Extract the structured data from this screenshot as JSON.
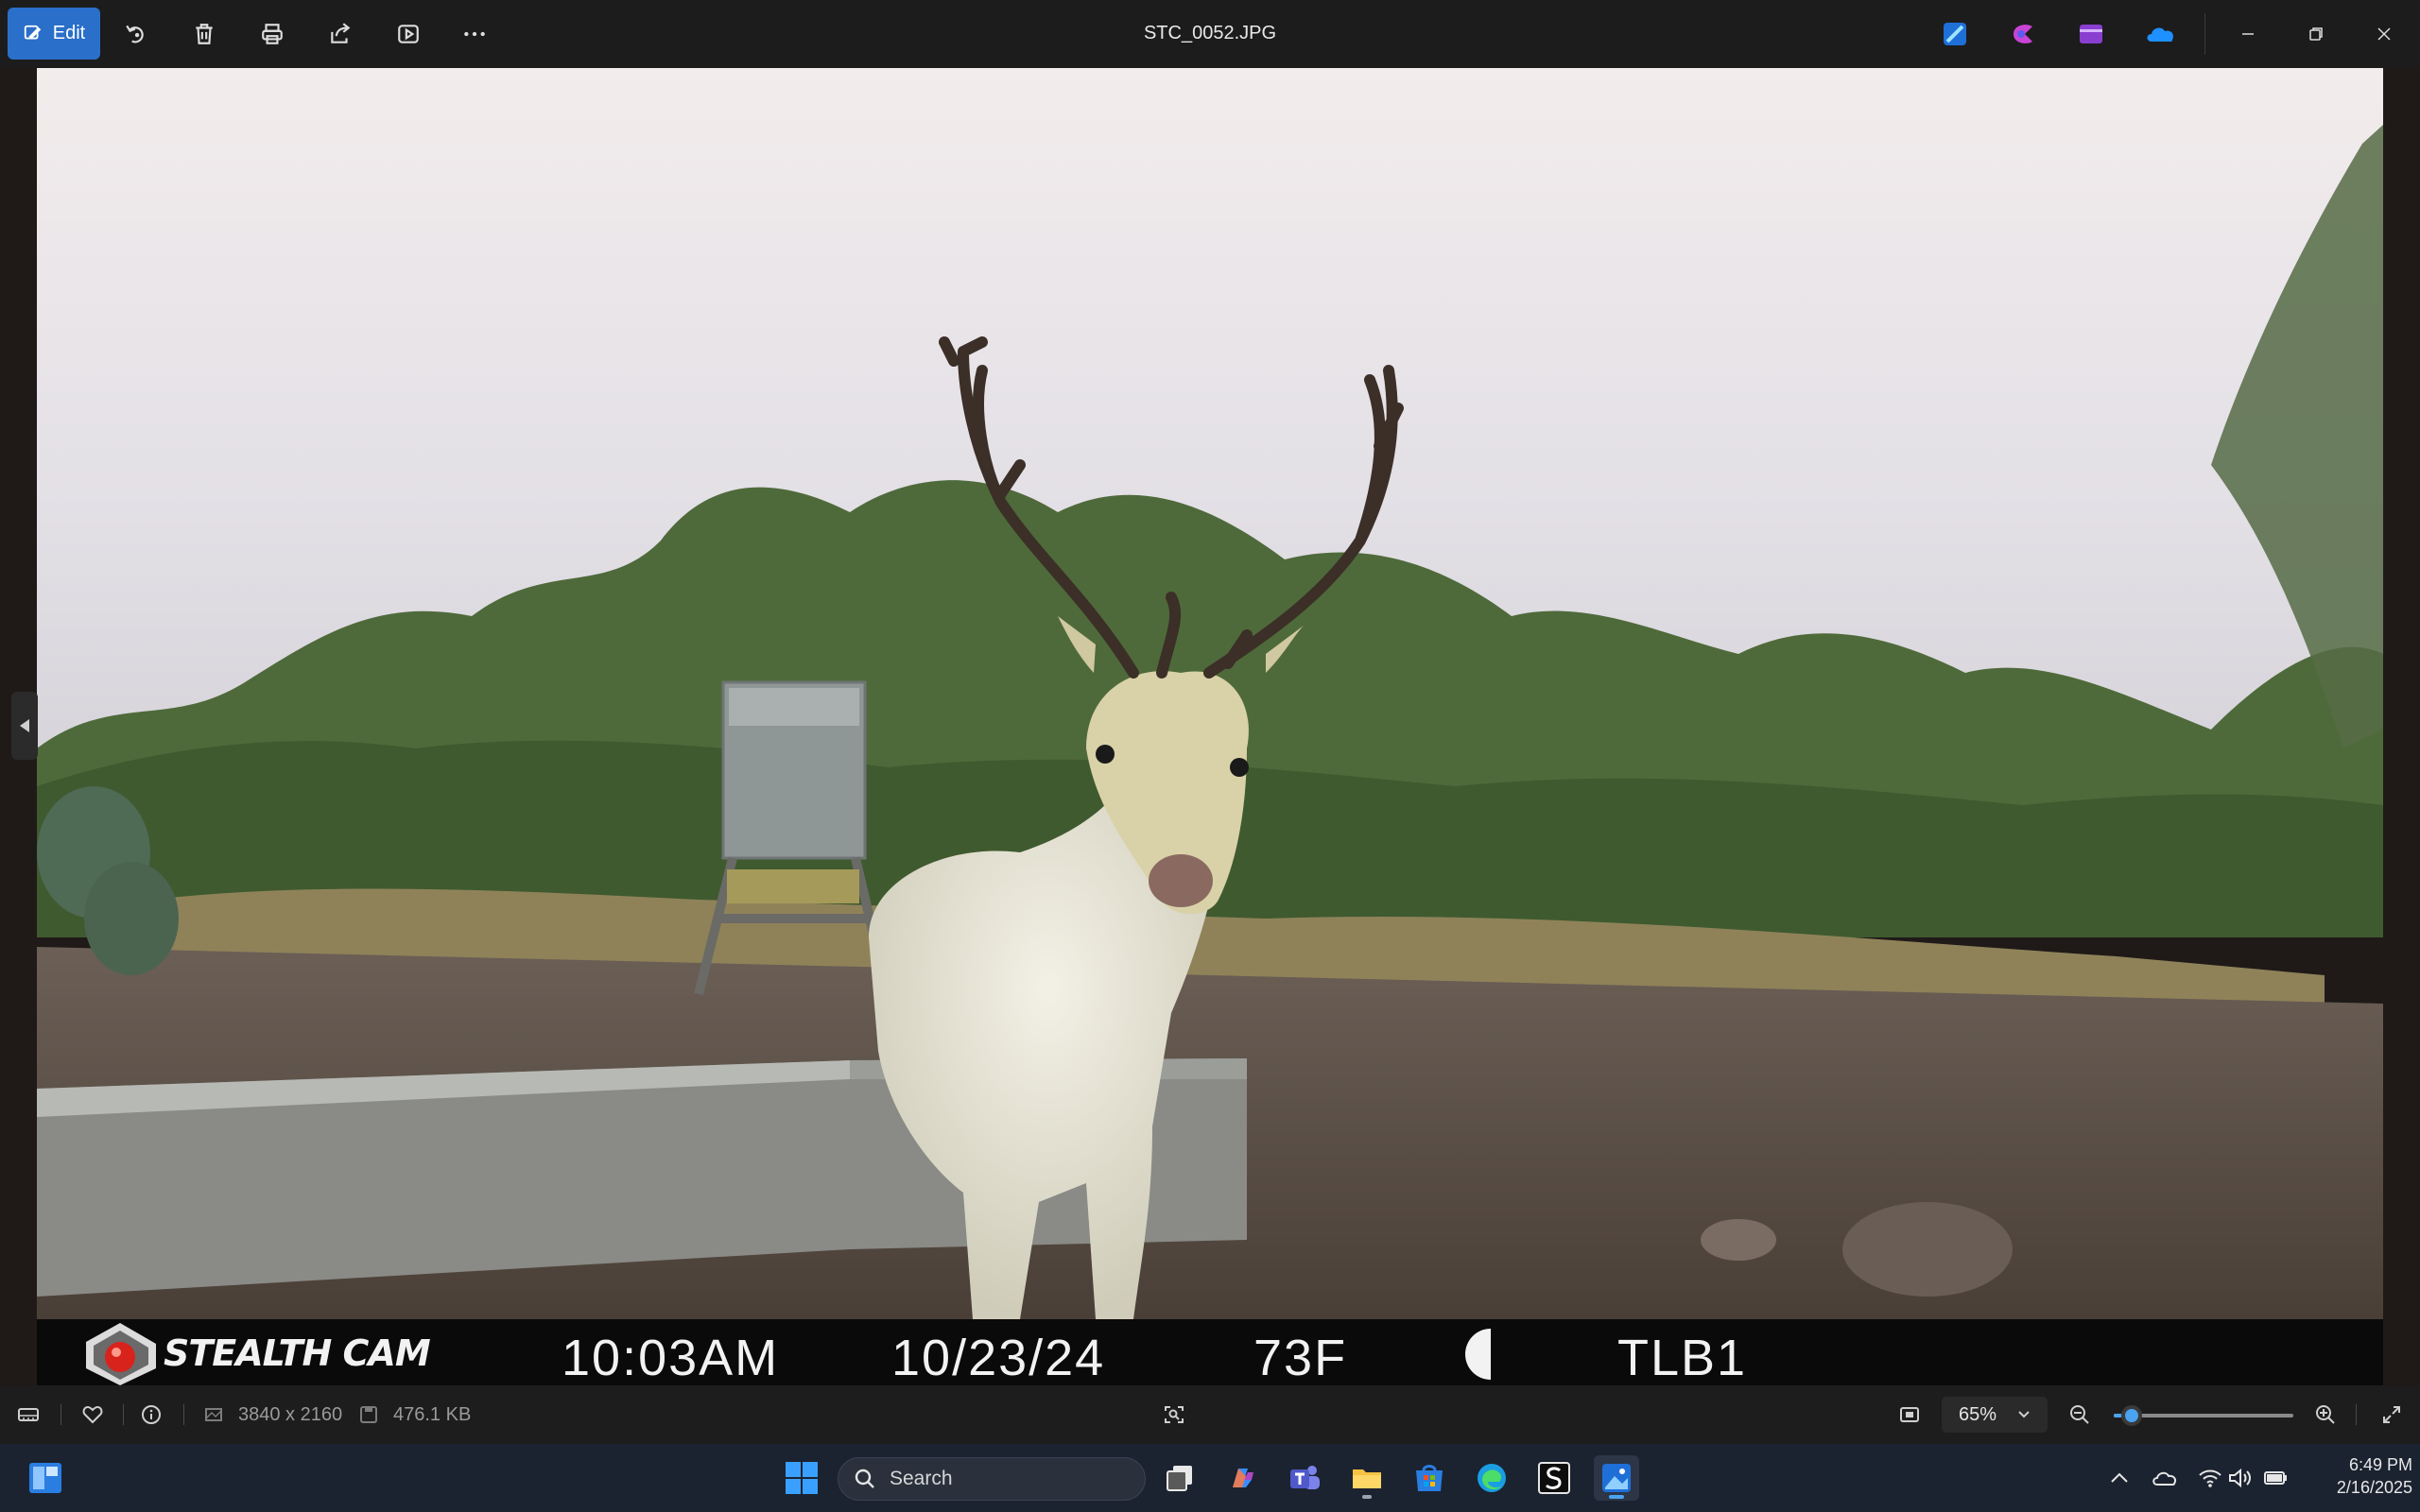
{
  "window": {
    "title": "STC_0052.JPG",
    "edit_label": "Edit"
  },
  "toolbar": {
    "icons": [
      "edit-icon",
      "rotate-icon",
      "delete-icon",
      "print-icon",
      "share-icon",
      "slideshow-icon",
      "more-icon"
    ]
  },
  "photo_overlay": {
    "brand": "STEALTH CAM",
    "time": "10:03AM",
    "date": "10/23/24",
    "temperature": "73F",
    "camera_id": "TLB1"
  },
  "status": {
    "dimensions": "3840 x 2160",
    "file_size": "476.1 KB",
    "zoom": "65%",
    "zoom_level": 0.1
  },
  "taskbar": {
    "search_placeholder": "Search",
    "time": "6:49 PM",
    "date": "2/16/2025"
  },
  "colors": {
    "accent": "#4ba3f0",
    "edit_button": "#2a6fc9",
    "taskbar": "#1b2330"
  }
}
